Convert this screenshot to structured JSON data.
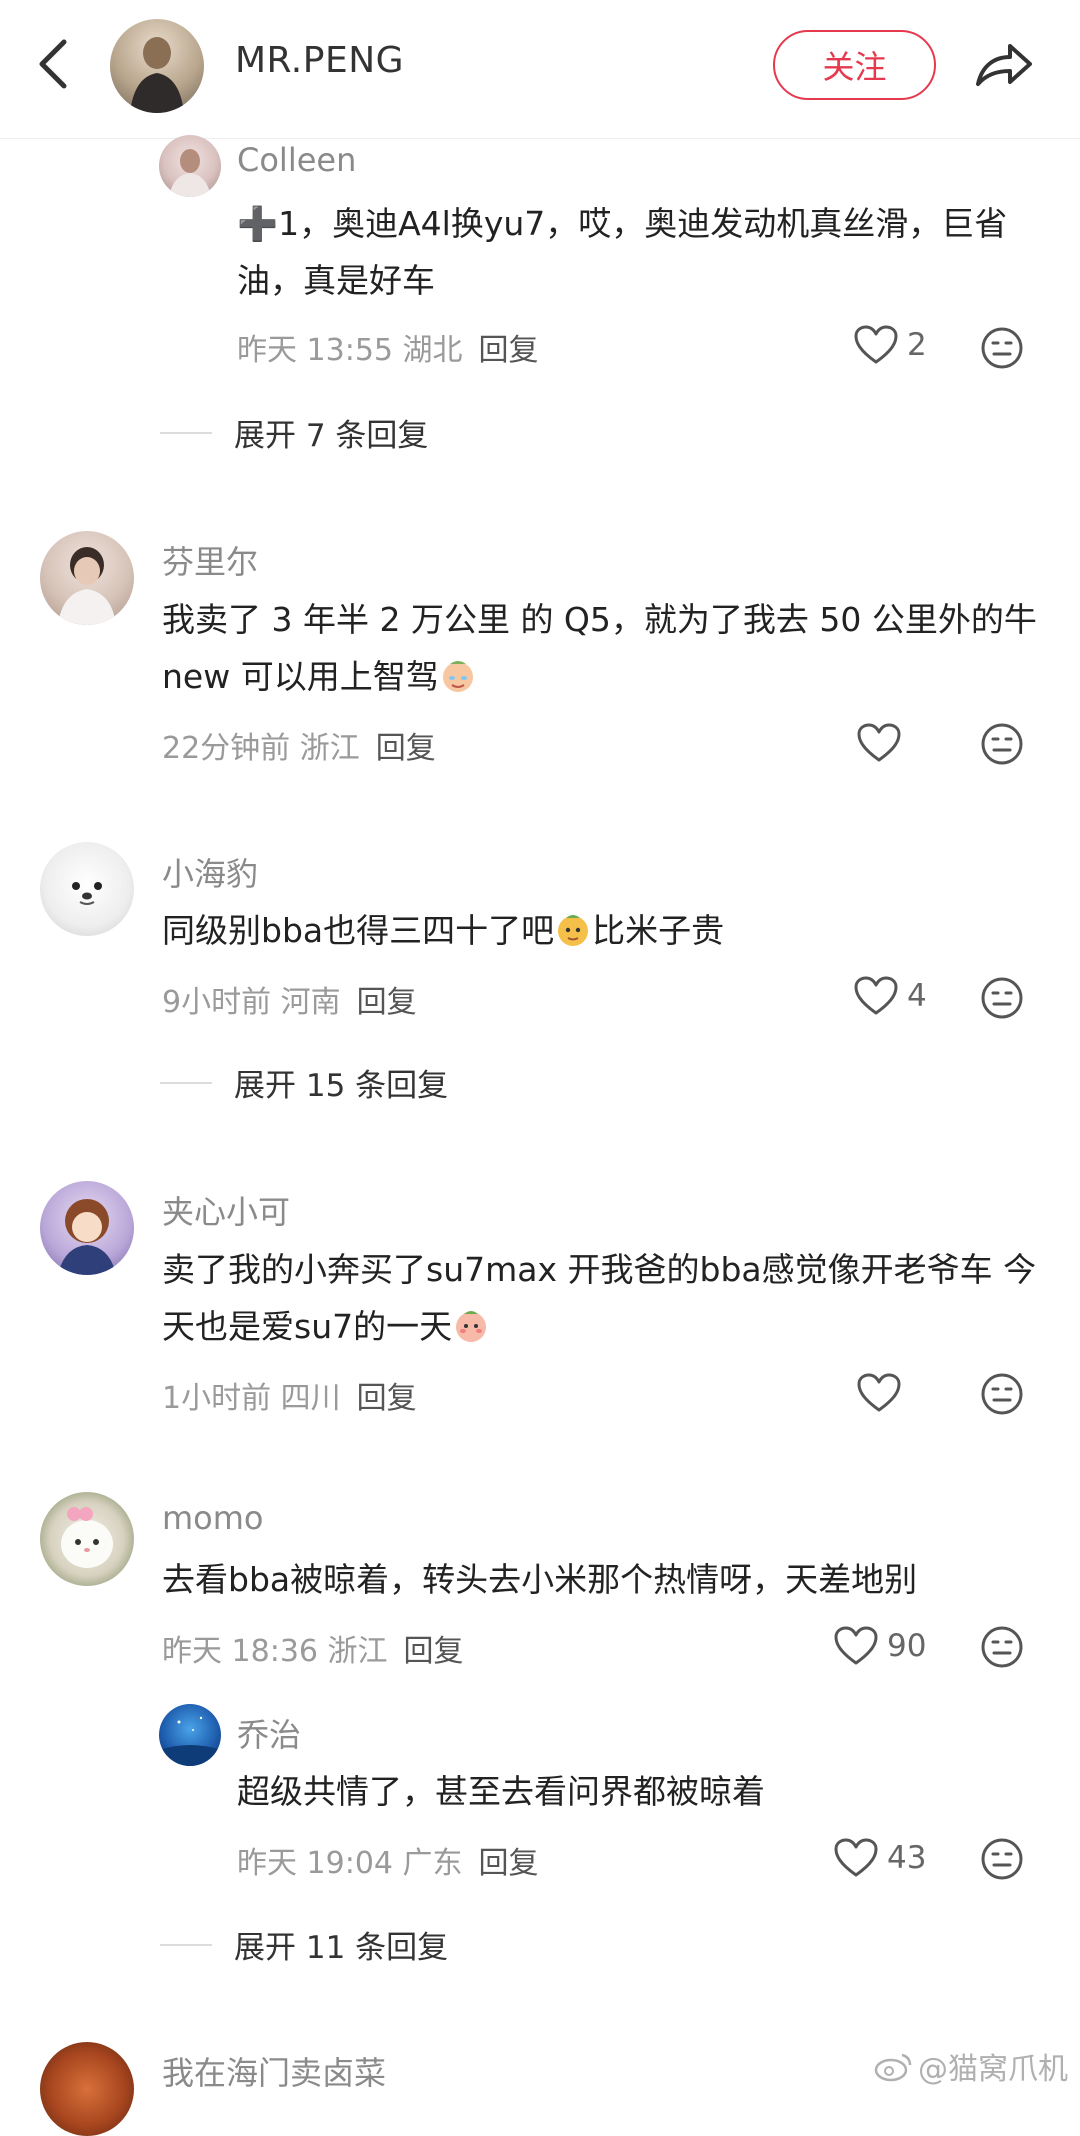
{
  "header": {
    "name": "MR.PENG",
    "follow_label": "关注"
  },
  "comments": [
    {
      "user": "Colleen",
      "text": "➕1，奥迪A4l换yu7，哎，奥迪发动机真丝滑，巨省油，真是好车",
      "time": "昨天 13:55 湖北",
      "reply_label": "回复",
      "likes": "2",
      "expand": "展开 7 条回复"
    },
    {
      "user": "芬里尔",
      "text_1": "我卖了 3 年半 2 万公里 的 Q5，就为了我去 50 公里外的牛new 可以用上智驾",
      "time": "22分钟前 浙江",
      "reply_label": "回复",
      "likes": ""
    },
    {
      "user": "小海豹",
      "text_1": "同级别bba也得三四十了吧",
      "text_2": "比米子贵",
      "time": "9小时前 河南",
      "reply_label": "回复",
      "likes": "4",
      "expand": "展开 15 条回复"
    },
    {
      "user": "夹心小可",
      "text_1": "卖了我的小奔买了su7max 开我爸的bba感觉像开老爷车 今天也是爱su7的一天",
      "time": "1小时前 四川",
      "reply_label": "回复",
      "likes": ""
    },
    {
      "user": "momo",
      "text": "去看bba被晾着，转头去小米那个热情呀，天差地别",
      "time": "昨天 18:36 浙江",
      "reply_label": "回复",
      "likes": "90"
    },
    {
      "user": "乔治",
      "text": "超级共情了，甚至去看问界都被晾着",
      "time": "昨天 19:04 广东",
      "reply_label": "回复",
      "likes": "43",
      "expand": "展开 11 条回复"
    },
    {
      "user": "我在海门卖卤菜"
    }
  ],
  "watermark": "@猫窝爪机",
  "icons": [
    "back-arrow-icon",
    "share-icon",
    "heart-icon",
    "emoji-face-icon",
    "weibo-logo-icon"
  ],
  "colors": {
    "accent": "#e5394e",
    "meta": "#9a9a9a",
    "text": "#222222"
  }
}
